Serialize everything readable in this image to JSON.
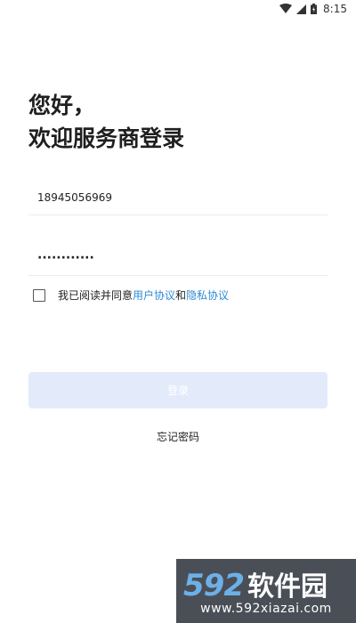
{
  "status_bar": {
    "time": "8:15",
    "icons": [
      "wifi-icon",
      "cell-signal-icon",
      "battery-icon"
    ]
  },
  "greeting": {
    "line1": "您好，",
    "line2": "欢迎服务商登录"
  },
  "phone_field": {
    "value": "18945056969"
  },
  "password_field": {
    "value": "············"
  },
  "agreement": {
    "checked": false,
    "prefix": "我已阅读并同意",
    "user_agreement": "用户协议",
    "and": "和",
    "privacy_policy": "隐私协议"
  },
  "login_button": {
    "label": "登录"
  },
  "forgot_password": {
    "label": "忘记密码"
  },
  "watermark": {
    "number": "592",
    "name": "软件园",
    "url": "www.592xiazai.com"
  },
  "colors": {
    "link": "#2f8bd6",
    "button_disabled_bg": "#e3ebfb",
    "watermark_bg": "#4a4f57",
    "watermark_accent": "#6db0e8"
  }
}
